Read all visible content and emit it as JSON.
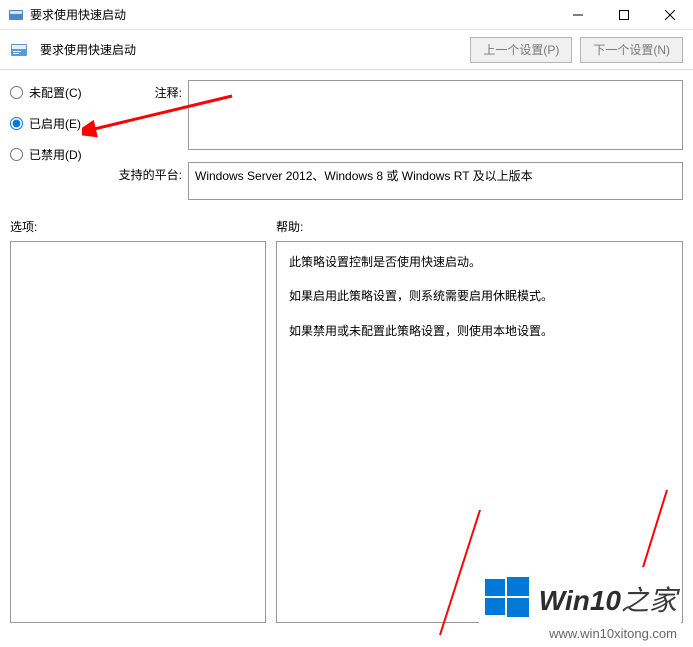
{
  "titlebar": {
    "title": "要求使用快速启动"
  },
  "toolbar": {
    "title": "要求使用快速启动",
    "prev_setting_label": "上一个设置(P)",
    "next_setting_label": "下一个设置(N)"
  },
  "radios": {
    "not_configured": "未配置(C)",
    "enabled": "已启用(E)",
    "disabled": "已禁用(D)",
    "selected": "enabled"
  },
  "fields": {
    "comment_label": "注释:",
    "comment_value": "",
    "platforms_label": "支持的平台:",
    "platforms_value": "Windows Server 2012、Windows 8 或 Windows RT 及以上版本"
  },
  "sections": {
    "options_label": "选项:",
    "help_label": "帮助:"
  },
  "help": {
    "p1": "此策略设置控制是否使用快速启动。",
    "p2": "如果启用此策略设置，则系统需要启用休眠模式。",
    "p3": "如果禁用或未配置此策略设置，则使用本地设置。"
  },
  "watermark": {
    "brand_prefix": "Win10",
    "brand_suffix": "之家",
    "url": "www.win10xitong.com"
  }
}
